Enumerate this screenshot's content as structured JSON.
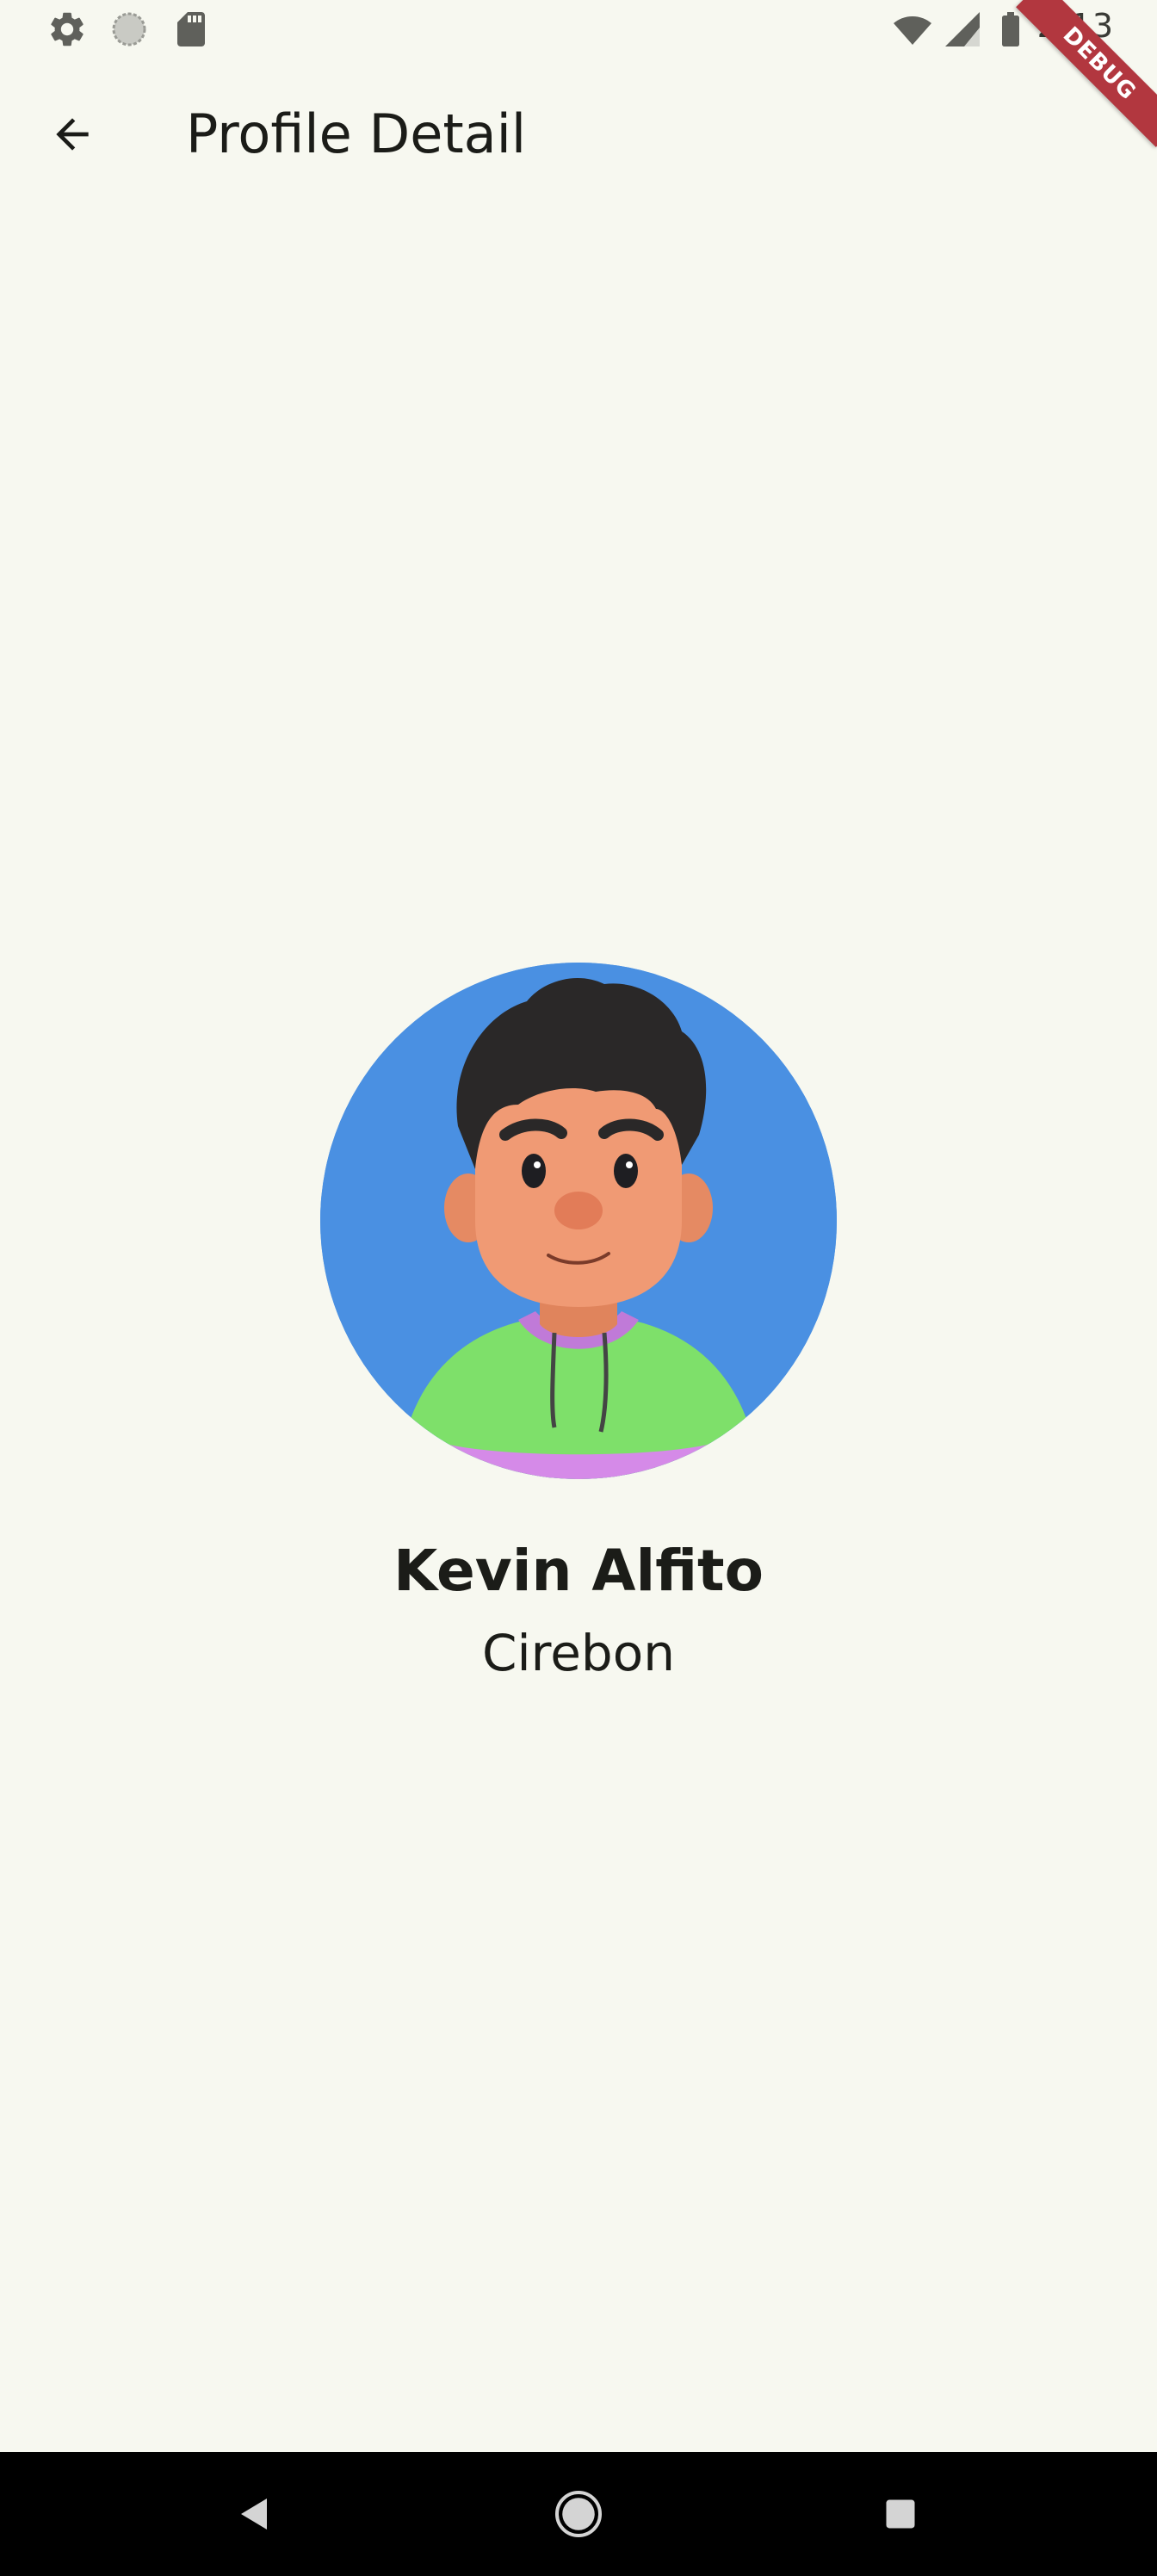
{
  "status_bar": {
    "time": "2:13",
    "icons": [
      "settings-icon",
      "sync-icon",
      "sd-card-icon",
      "wifi-icon",
      "signal-icon",
      "battery-icon"
    ]
  },
  "debug_banner": {
    "label": "DEBUG",
    "color": "#b2373f"
  },
  "app_bar": {
    "title": "Profile Detail",
    "back_icon": "arrow-back-icon"
  },
  "profile": {
    "name": "Kevin Alfito",
    "city": "Cirebon",
    "avatar_background": "#4a90e2"
  },
  "nav_bar": {
    "items": [
      "back-icon",
      "home-icon",
      "recents-icon"
    ]
  },
  "colors": {
    "background": "#f7f8f0",
    "text": "#1b1c18"
  }
}
